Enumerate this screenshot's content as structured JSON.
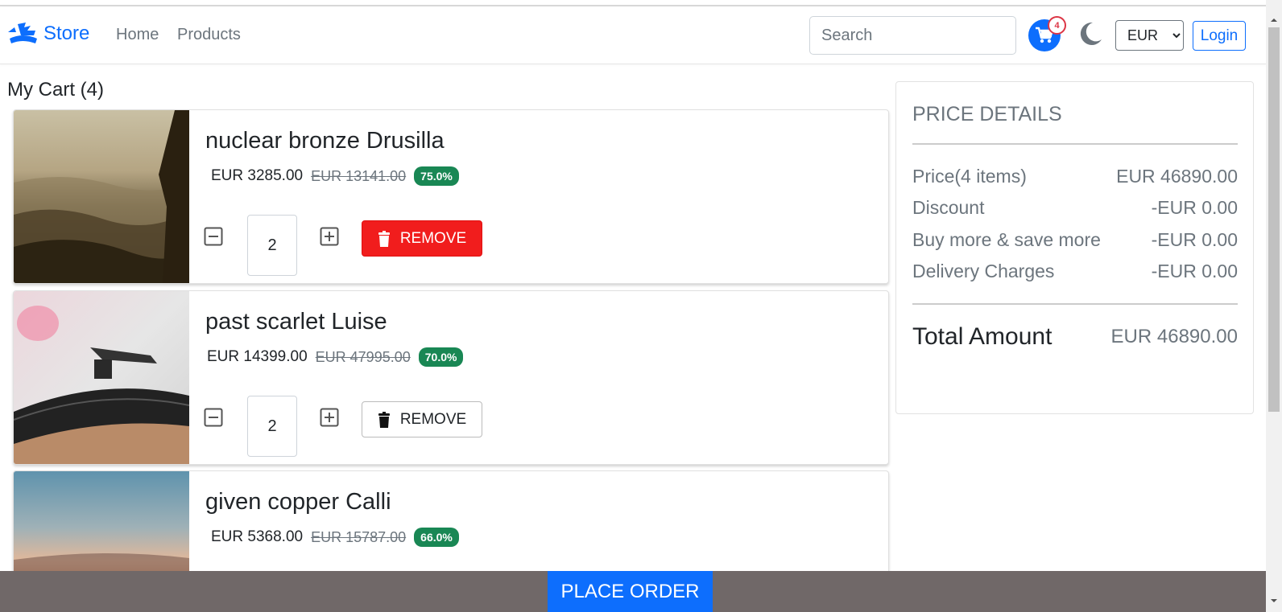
{
  "header": {
    "brand": "Store",
    "nav": [
      "Home",
      "Products"
    ],
    "search_placeholder": "Search",
    "cart_count": "4",
    "currency": "EUR",
    "currency_options": [
      "EUR"
    ],
    "login": "Login"
  },
  "cart": {
    "title": "My Cart (4)",
    "items": [
      {
        "name": "nuclear bronze Drusilla",
        "price": "EUR 3285.00",
        "old_price": "EUR 13141.00",
        "discount": "75.0%",
        "qty": "2",
        "remove": "REMOVE"
      },
      {
        "name": "past scarlet Luise",
        "price": "EUR 14399.00",
        "old_price": "EUR 47995.00",
        "discount": "70.0%",
        "qty": "2",
        "remove": "REMOVE"
      },
      {
        "name": "given copper Calli",
        "price": "EUR 5368.00",
        "old_price": "EUR 15787.00",
        "discount": "66.0%",
        "qty": "",
        "remove": ""
      }
    ]
  },
  "price_details": {
    "title": "PRICE DETAILS",
    "rows": [
      {
        "label": "Price(4 items)",
        "value": "EUR 46890.00"
      },
      {
        "label": "Discount",
        "value": "-EUR 0.00"
      },
      {
        "label": "Buy more & save more",
        "value": "-EUR 0.00"
      },
      {
        "label": "Delivery Charges",
        "value": "-EUR 0.00"
      }
    ],
    "total_label": "Total Amount",
    "total_value": "EUR 46890.00"
  },
  "footer": {
    "place_order": "PLACE ORDER"
  },
  "colors": {
    "primary": "#0d6efd",
    "danger": "#f11d1d",
    "success": "#198754",
    "footer_bar": "#706868"
  }
}
